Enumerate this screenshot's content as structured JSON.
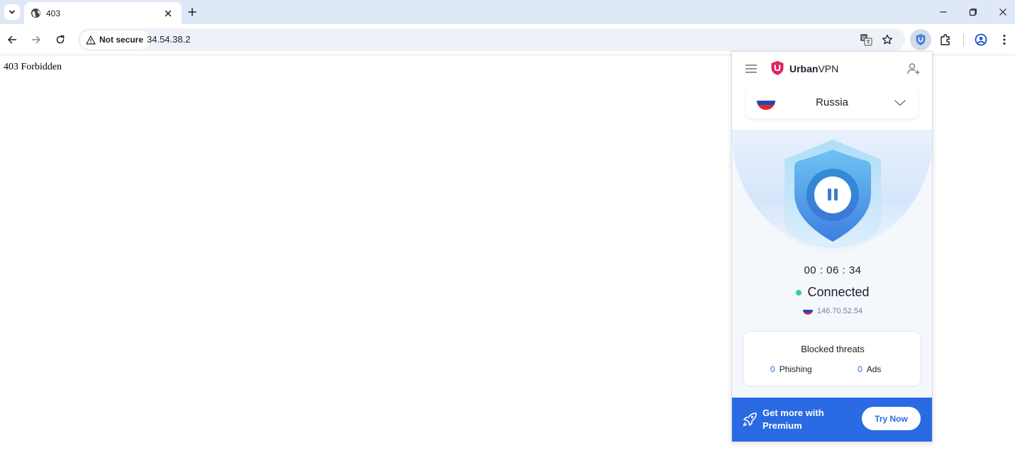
{
  "browser": {
    "tab": {
      "title": "403",
      "favicon": "globe-icon"
    },
    "new_tab_icon": "plus-icon",
    "window_controls": [
      "minimize-icon",
      "restore-icon",
      "close-icon"
    ],
    "toolbar": {
      "security_label": "Not secure",
      "url": "34.54.38.2",
      "icons": [
        "back-icon",
        "forward-icon",
        "reload-icon",
        "translate-icon",
        "star-icon",
        "urban-vpn-extension-icon",
        "extensions-icon",
        "profile-icon",
        "more-icon"
      ]
    }
  },
  "page": {
    "text": "403 Forbidden"
  },
  "vpn_popup": {
    "brand_bold": "Urban",
    "brand_light": "VPN",
    "country": "Russia",
    "timer": "00 : 06 : 34",
    "status": "Connected",
    "ip": "146.70.52.54",
    "threats": {
      "title": "Blocked threats",
      "phishing_count": "0",
      "phishing_label": "Phishing",
      "ads_count": "0",
      "ads_label": "Ads"
    },
    "premium": {
      "text": "Get more with Premium",
      "button": "Try Now"
    },
    "colors": {
      "accent": "#2a6ae3",
      "connected": "#3fc7a6",
      "brand": "#e0245e"
    }
  }
}
